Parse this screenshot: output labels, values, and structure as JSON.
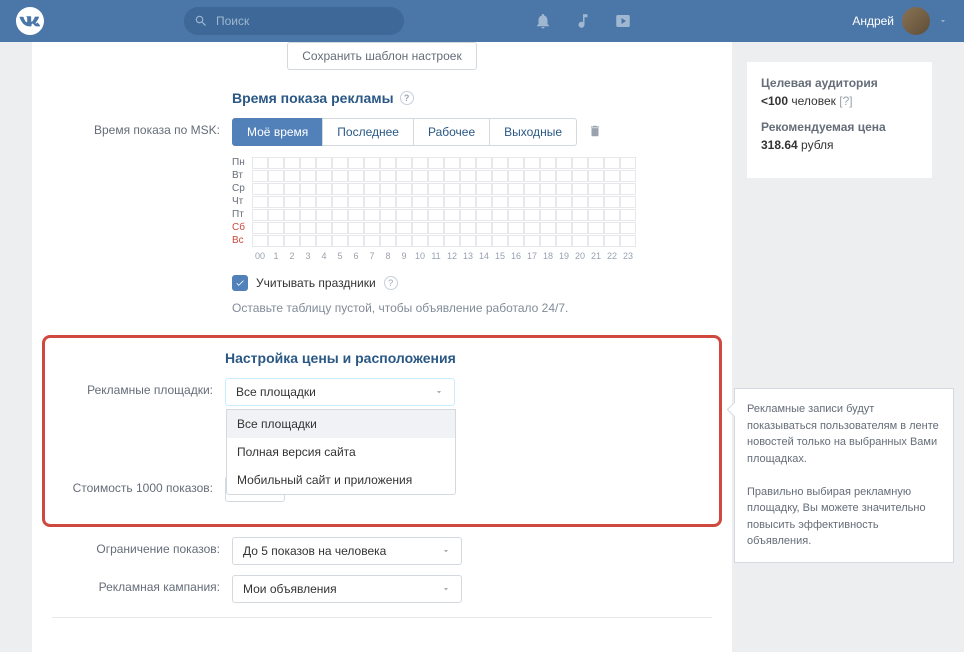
{
  "header": {
    "search_placeholder": "Поиск",
    "username": "Андрей"
  },
  "save_template_button": "Сохранить шаблон настроек",
  "schedule": {
    "title": "Время показа рекламы",
    "label": "Время показа по MSK:",
    "tabs": [
      "Моё время",
      "Последнее",
      "Рабочее",
      "Выходные"
    ],
    "days": [
      "Пн",
      "Вт",
      "Ср",
      "Чт",
      "Пт",
      "Сб",
      "Вс"
    ],
    "hours": [
      "00",
      "1",
      "2",
      "3",
      "4",
      "5",
      "6",
      "7",
      "8",
      "9",
      "10",
      "11",
      "12",
      "13",
      "14",
      "15",
      "16",
      "17",
      "18",
      "19",
      "20",
      "21",
      "22",
      "23"
    ],
    "checkbox_label": "Учитывать праздники",
    "hint": "Оставьте таблицу пустой, чтобы объявление работало 24/7."
  },
  "pricing": {
    "title": "Настройка цены и расположения",
    "platforms_label": "Рекламные площадки:",
    "platforms_value": "Все площадки",
    "platforms_options": [
      "Все площадки",
      "Полная версия сайта",
      "Мобильный сайт и приложения"
    ],
    "tooltip_p1": "Рекламные записи будут показываться пользователям в ленте новостей только на выбранных Вами площадках.",
    "tooltip_p2": "Правильно выбирая рекламную площадку, Вы можете значительно повысить эффективность объявления.",
    "cost_label": "Стоимость 1000 показов:",
    "limit_label": "Ограничение показов:",
    "limit_value": "До 5 показов на человека",
    "campaign_label": "Рекламная кампания:",
    "campaign_value": "Мои объявления"
  },
  "sidebar": {
    "audience_label": "Целевая аудитория",
    "audience_value": "<100",
    "audience_unit": "человек",
    "q": "[?]",
    "price_label": "Рекомендуемая цена",
    "price_value": "318.64",
    "price_unit": "рубля"
  }
}
